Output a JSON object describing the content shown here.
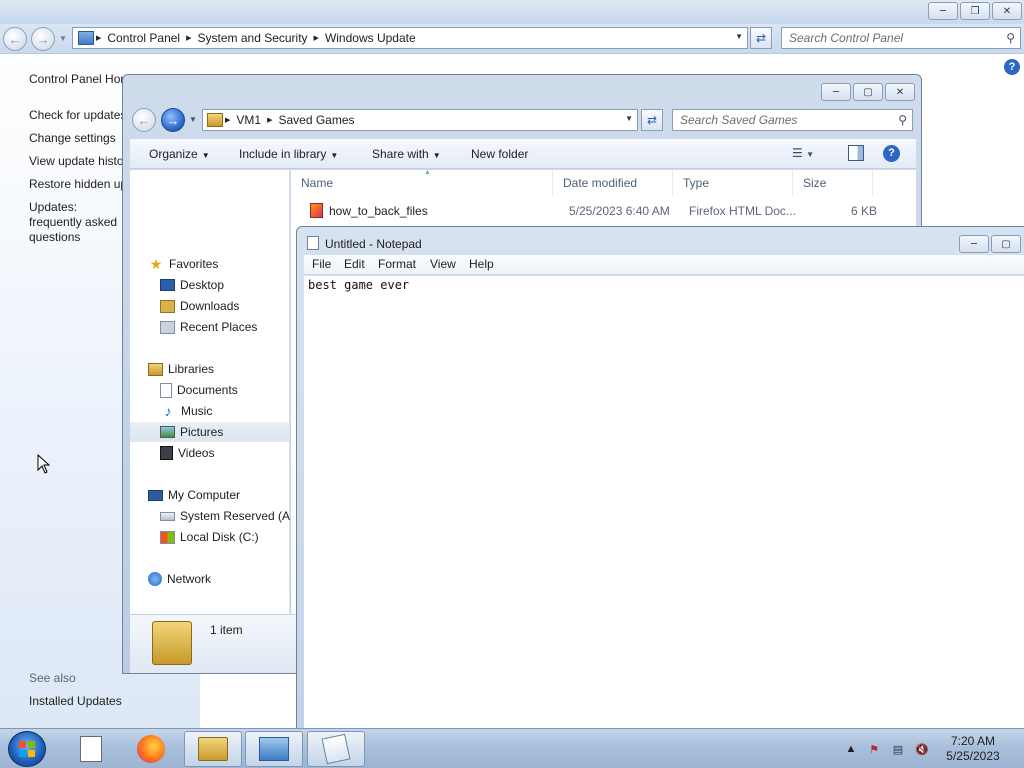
{
  "control_panel": {
    "breadcrumb": [
      "Control Panel",
      "System and Security",
      "Windows Update"
    ],
    "search_placeholder": "Search Control Panel",
    "left_links": [
      "Control Panel Home",
      "Check for updates",
      "Change settings",
      "View update history",
      "Restore hidden updates",
      "Updates: frequently asked questions"
    ],
    "see_also": "See also",
    "installed_updates": "Installed Updates"
  },
  "explorer": {
    "breadcrumb": [
      "VM1",
      "Saved Games"
    ],
    "search_placeholder": "Search Saved Games",
    "toolbar": {
      "organize": "Organize",
      "include": "Include in library",
      "share": "Share with",
      "new_folder": "New folder"
    },
    "nav": {
      "favorites": "Favorites",
      "desktop": "Desktop",
      "downloads": "Downloads",
      "recent": "Recent Places",
      "libraries": "Libraries",
      "documents": "Documents",
      "music": "Music",
      "pictures": "Pictures",
      "videos": "Videos",
      "computer": "My Computer",
      "system_reserved": "System Reserved (A:)",
      "local_disk": "Local Disk (C:)",
      "network": "Network"
    },
    "columns": {
      "name": "Name",
      "date": "Date modified",
      "type": "Type",
      "size": "Size"
    },
    "files": [
      {
        "name": "how_to_back_files",
        "date": "5/25/2023 6:40 AM",
        "type": "Firefox HTML Doc...",
        "size": "6 KB"
      }
    ],
    "status": "1 item"
  },
  "notepad": {
    "title": "Untitled - Notepad",
    "menu": {
      "file": "File",
      "edit": "Edit",
      "format": "Format",
      "view": "View",
      "help": "Help"
    },
    "content": "best game ever"
  },
  "taskbar": {
    "time": "7:20 AM",
    "date": "5/25/2023"
  },
  "colors": {
    "accent": "#2c67c4",
    "taskbar": "#a8bfdb",
    "window_frame": "#c3d3e8"
  }
}
